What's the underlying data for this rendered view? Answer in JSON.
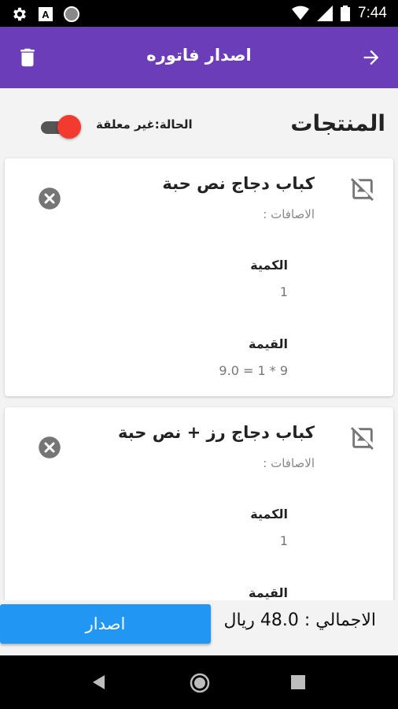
{
  "status_bar": {
    "time": "7:44",
    "icons": [
      "settings-icon",
      "a-badge-icon",
      "circle-icon",
      "wifi-icon",
      "signal-icon",
      "battery-icon"
    ]
  },
  "app_bar": {
    "title": "اصدار فاتوره",
    "left_icon": "trash-icon",
    "right_icon": "arrow-forward-icon",
    "color": "#6c3db9"
  },
  "products_section": {
    "title": "المنتجات",
    "status_label": "الحالة:غير معلقة",
    "toggle_on": true,
    "toggle_color": "#f23a2e"
  },
  "products": [
    {
      "name": "كباب دجاج نص حبة",
      "addons_label": "الاصافات :",
      "quantity_label": "الكمية",
      "quantity": "1",
      "price_label": "القيمة",
      "price_expression": "9 * 1 = 9.0"
    },
    {
      "name": "كباب دجاج رز + نص حبة",
      "addons_label": "الاصافات :",
      "quantity_label": "الكمية",
      "quantity": "1",
      "price_label": "القيمة"
    }
  ],
  "footer": {
    "total_text": "الاجمالي : 48.0 ريال",
    "issue_button": "اصدار",
    "button_color": "#2196f3"
  },
  "nav_bar": {
    "icons": [
      "back-triangle-icon",
      "home-circle-icon",
      "recents-square-icon"
    ]
  }
}
